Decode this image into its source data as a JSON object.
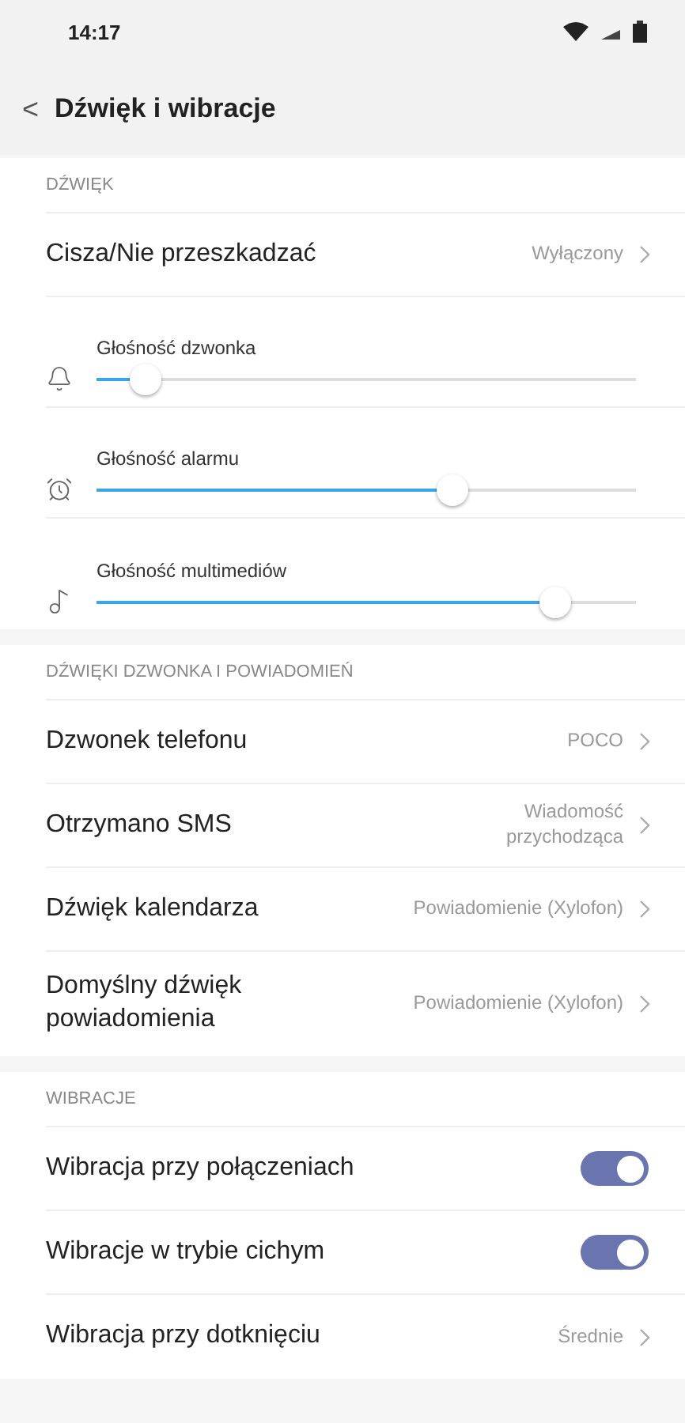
{
  "status_bar": {
    "time": "14:17"
  },
  "header": {
    "back": "<",
    "title": "Dźwięk i wibracje"
  },
  "sections": [
    {
      "title": "DŹWIĘK",
      "items": [
        {
          "kind": "link",
          "label": "Cisza/Nie przeszkadzać",
          "value": "Wyłączony"
        },
        {
          "kind": "slider",
          "label": "Głośność dzwonka",
          "level": 0.09
        },
        {
          "kind": "slider",
          "label": "Głośność alarmu",
          "level": 0.66
        },
        {
          "kind": "slider",
          "label": "Głośność multimediów",
          "level": 0.85
        }
      ]
    },
    {
      "title": "DŹWIĘKI DZWONKA I POWIADOMIEŃ",
      "items": [
        {
          "kind": "link",
          "label": "Dzwonek telefonu",
          "value": "POCO"
        },
        {
          "kind": "link",
          "label": "Otrzymano SMS",
          "value": "Wiadomość\nprzychodząca"
        },
        {
          "kind": "link",
          "label": "Dźwięk kalendarza",
          "value": "Powiadomienie (Xylofon)"
        },
        {
          "kind": "link",
          "label": "Domyślny dźwięk\npowiadomienia",
          "value": "Powiadomienie (Xylofon)"
        }
      ]
    },
    {
      "title": "WIBRACJE",
      "items": [
        {
          "kind": "toggle",
          "label": "Wibracja przy połączeniach",
          "on": true
        },
        {
          "kind": "toggle",
          "label": "Wibracje w trybie cichym",
          "on": true
        },
        {
          "kind": "link",
          "label": "Wibracja przy dotknięciu",
          "value": "Średnie"
        }
      ]
    }
  ]
}
